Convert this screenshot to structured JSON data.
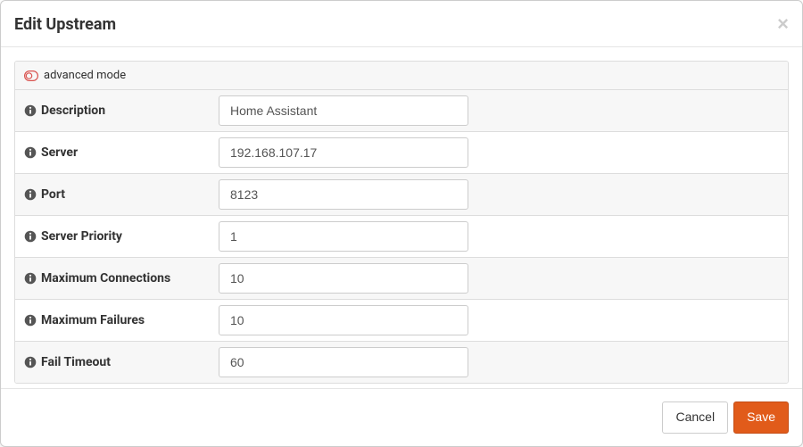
{
  "modal": {
    "title": "Edit Upstream",
    "advanced_label": "advanced mode"
  },
  "fields": {
    "description": {
      "label": "Description",
      "value": "Home Assistant"
    },
    "server": {
      "label": "Server",
      "value": "192.168.107.17"
    },
    "port": {
      "label": "Port",
      "value": "8123"
    },
    "priority": {
      "label": "Server Priority",
      "value": "1"
    },
    "max_conn": {
      "label": "Maximum Connections",
      "value": "10"
    },
    "max_fail": {
      "label": "Maximum Failures",
      "value": "10"
    },
    "fail_timeout": {
      "label": "Fail Timeout",
      "value": "60"
    }
  },
  "buttons": {
    "cancel": "Cancel",
    "save": "Save"
  }
}
